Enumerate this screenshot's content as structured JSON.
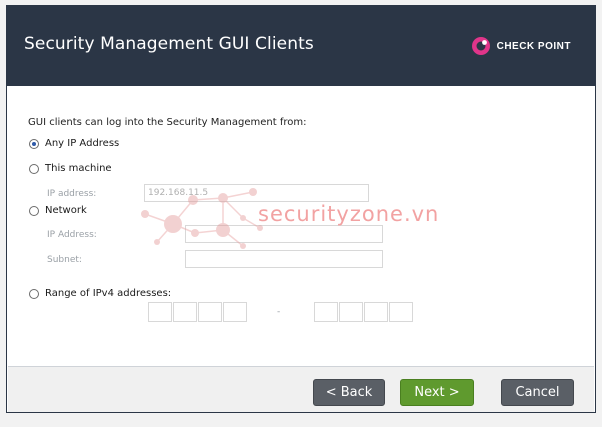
{
  "window": {
    "title": "Security Management GUI Clients",
    "brand": "CHECK POINT"
  },
  "content": {
    "intro": "GUI clients can log into the Security Management from:",
    "options": {
      "any_ip": "Any IP Address",
      "this_machine": "This machine",
      "network": "Network",
      "range": "Range of IPv4 addresses:"
    },
    "this_machine_ip_label": "IP address:",
    "this_machine_ip_value": "192.168.11.5",
    "network_ip_label": "IP Address:",
    "network_subnet_label": "Subnet:",
    "range_separator": "-",
    "selected_option": "any_ip"
  },
  "watermark": "securityzone.vn",
  "buttons": {
    "back": "< Back",
    "next": "Next >",
    "cancel": "Cancel"
  },
  "colors": {
    "header_bg": "#2b3646",
    "next_button": "#5f9a2e",
    "secondary_button": "#5a5f66",
    "brand_pink": "#e0358a"
  }
}
